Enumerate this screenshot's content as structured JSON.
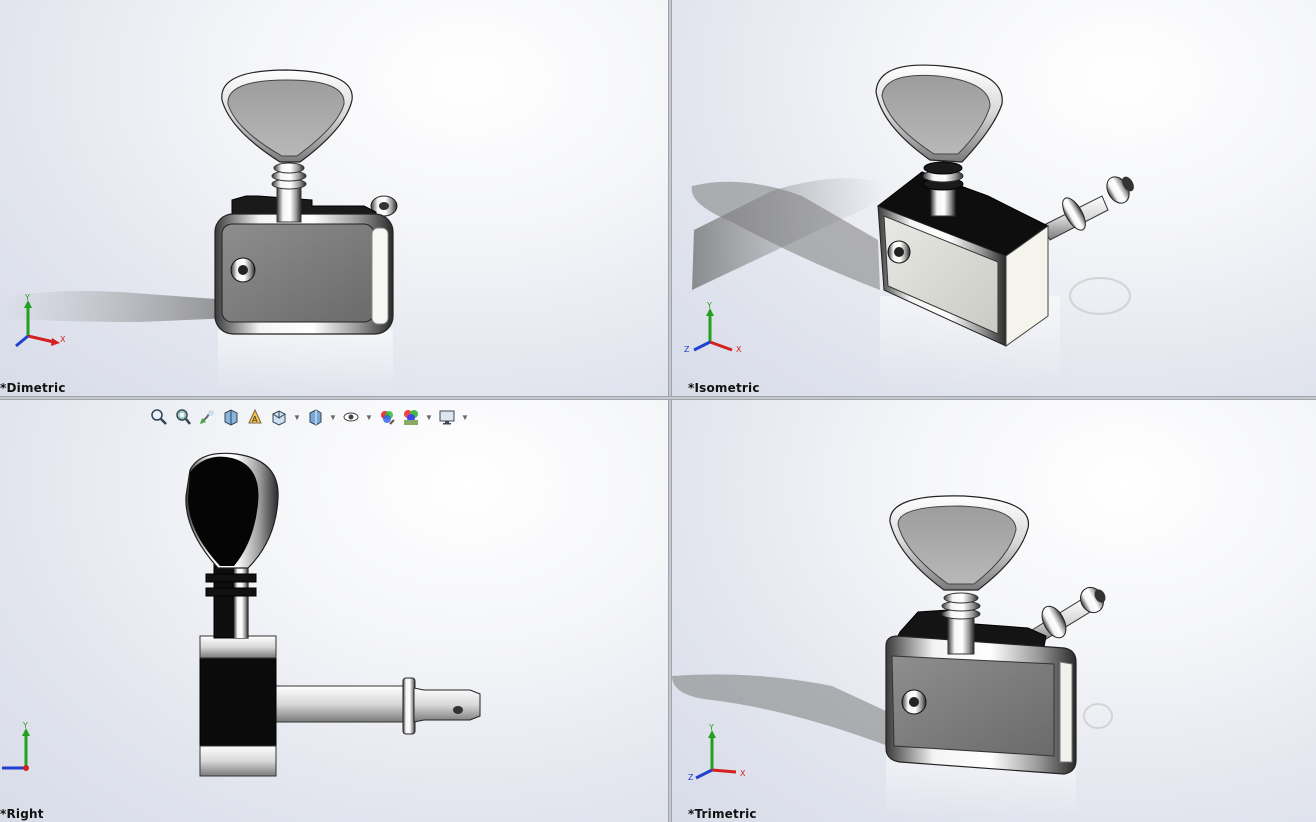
{
  "viewports": {
    "top_left": {
      "label": "*Dimetric"
    },
    "top_right": {
      "label": "*Isometric"
    },
    "bottom_left": {
      "label": "*Right"
    },
    "bottom_right": {
      "label": "*Trimetric"
    }
  },
  "triad": {
    "x": "X",
    "y": "Y",
    "z": "Z"
  },
  "heads_up_toolbar": {
    "items": [
      {
        "icon": "zoom-to-fit-icon"
      },
      {
        "icon": "zoom-to-area-icon"
      },
      {
        "icon": "previous-view-icon"
      },
      {
        "icon": "section-view-icon"
      },
      {
        "icon": "dynamic-annotation-views-icon"
      },
      {
        "icon": "view-orientation-icon",
        "dropdown": true
      },
      {
        "icon": "display-style-icon",
        "dropdown": true
      },
      {
        "icon": "hide-show-items-icon",
        "dropdown": true
      },
      {
        "icon": "edit-appearance-icon"
      },
      {
        "icon": "apply-scene-icon",
        "dropdown": true
      },
      {
        "icon": "view-settings-icon",
        "dropdown": true
      }
    ]
  },
  "colors": {
    "axis_x": "#d42020",
    "axis_y": "#22a022",
    "axis_z": "#2040d0",
    "chrome": "#f2f3f5",
    "dark_chrome": "#111111"
  }
}
